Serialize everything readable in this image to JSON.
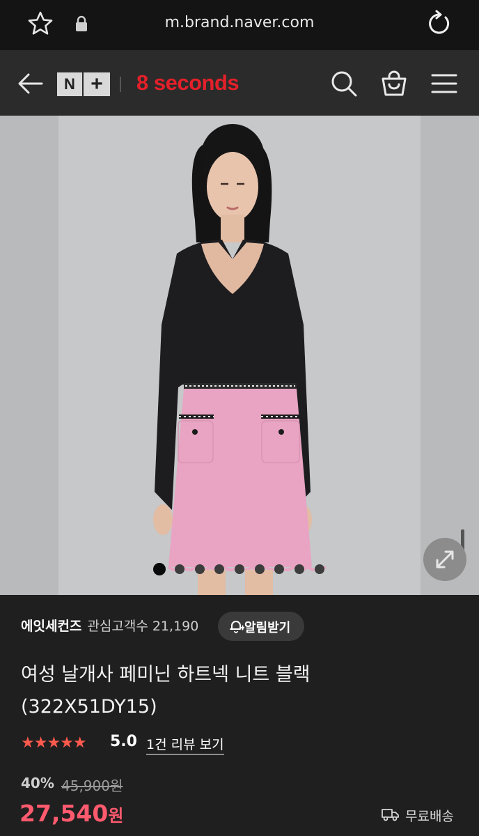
{
  "browser": {
    "url": "m.brand.naver.com"
  },
  "header": {
    "logo_n": "N",
    "logo_plus": "+",
    "brand_logo": "8 seconds",
    "colors": {
      "brand": "#e4202a"
    }
  },
  "gallery": {
    "image_count": 9,
    "active_index": 0
  },
  "store": {
    "name": "에잇세컨즈",
    "fans_label": "관심고객수 21,190",
    "alarm_label": "알림받기"
  },
  "product": {
    "title_line1": "여성 날개사 페미닌 하트넥 니트 블랙",
    "title_line2": "(322X51DY15)",
    "stars": "★★★★★",
    "rating": "5.0",
    "review_link": "1건 리뷰 보기",
    "discount": "40%",
    "original_price": "45,900원",
    "price": "27,540",
    "price_unit": "원",
    "shipping": "무료배송",
    "colors": {
      "price": "#ff5a6e",
      "stars": "#ff5a4e"
    }
  }
}
